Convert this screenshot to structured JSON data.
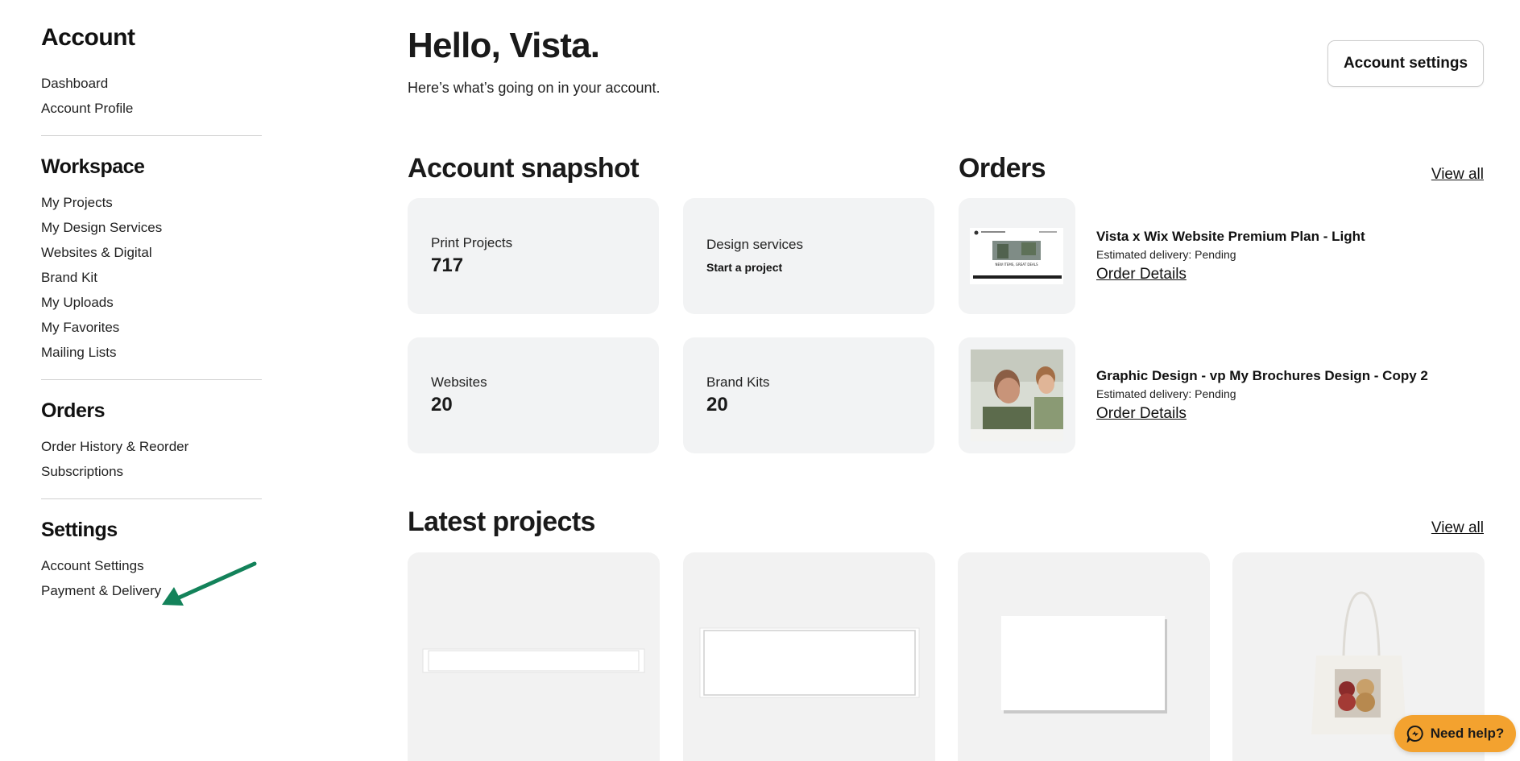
{
  "sidebar": {
    "title": "Account",
    "account_items": [
      "Dashboard",
      "Account Profile"
    ],
    "workspace_title": "Workspace",
    "workspace_items": [
      "My Projects",
      "My Design Services",
      "Websites & Digital",
      "Brand Kit",
      "My Uploads",
      "My Favorites",
      "Mailing Lists"
    ],
    "orders_title": "Orders",
    "orders_items": [
      "Order History & Reorder",
      "Subscriptions"
    ],
    "settings_title": "Settings",
    "settings_items": [
      "Account Settings",
      "Payment & Delivery"
    ]
  },
  "header": {
    "greeting": "Hello, Vista.",
    "subtitle": "Here’s what’s going on in your account.",
    "settings_button": "Account settings"
  },
  "snapshot": {
    "title": "Account snapshot",
    "tiles": [
      {
        "label": "Print Projects",
        "value": "717"
      },
      {
        "label": "Design services",
        "link": "Start a project"
      },
      {
        "label": "Websites",
        "value": "20"
      },
      {
        "label": "Brand Kits",
        "value": "20"
      }
    ]
  },
  "orders": {
    "title": "Orders",
    "view_all": "View all",
    "items": [
      {
        "name": "Vista x Wix Website Premium Plan - Light",
        "delivery": "Estimated delivery: Pending",
        "link": "Order Details",
        "thumb_text": "NEW ITEMS, GREAT DEALS"
      },
      {
        "name": "Graphic Design - vp My Brochures Design - Copy 2",
        "delivery": "Estimated delivery: Pending",
        "link": "Order Details"
      }
    ]
  },
  "projects": {
    "title": "Latest projects",
    "view_all": "View all"
  },
  "help": {
    "label": "Need help?"
  },
  "colors": {
    "accent_arrow": "#13825a",
    "help_button": "#f3a22f",
    "tile_bg": "#f2f3f4"
  }
}
